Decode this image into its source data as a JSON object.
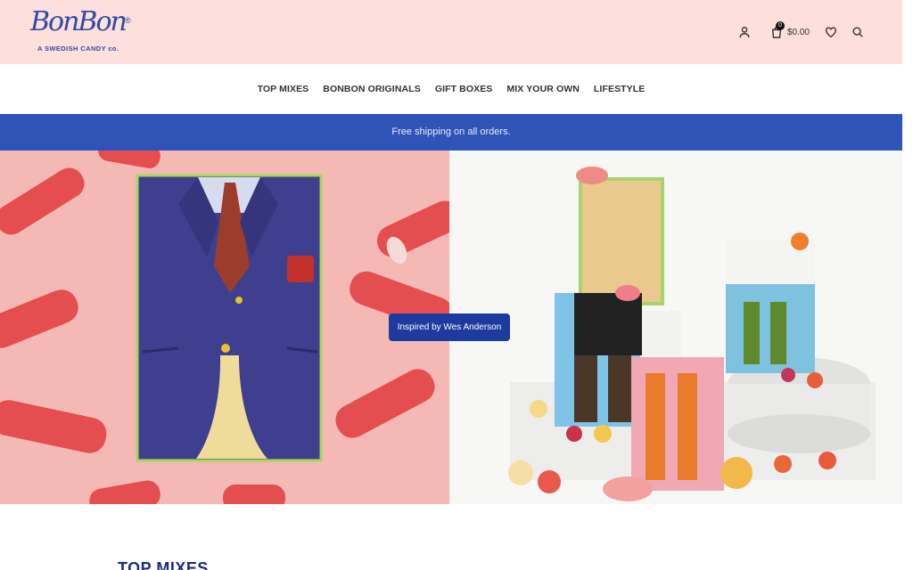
{
  "brand": {
    "name": "BonBon",
    "registered": "®",
    "tagline": "A SWEDISH CANDY co."
  },
  "header": {
    "cart_count": "0",
    "cart_total": "$0.00"
  },
  "nav": {
    "items": [
      {
        "label": "TOP MIXES"
      },
      {
        "label": "BONBON ORIGINALS"
      },
      {
        "label": "GIFT BOXES"
      },
      {
        "label": "MIX YOUR OWN"
      },
      {
        "label": "LIFESTYLE"
      }
    ]
  },
  "announcement": {
    "text": "Free shipping on all orders."
  },
  "hero": {
    "cta_label": "Inspired by Wes Anderson"
  },
  "sections": {
    "first_title": "TOP MIXES"
  },
  "colors": {
    "header_bg": "#fde0dc",
    "accent_blue": "#3053b7",
    "cta_blue": "#1d3a9e",
    "brand_blue": "#2d4aa8"
  },
  "icons": [
    "user-icon",
    "cart-icon",
    "heart-icon",
    "search-icon"
  ]
}
